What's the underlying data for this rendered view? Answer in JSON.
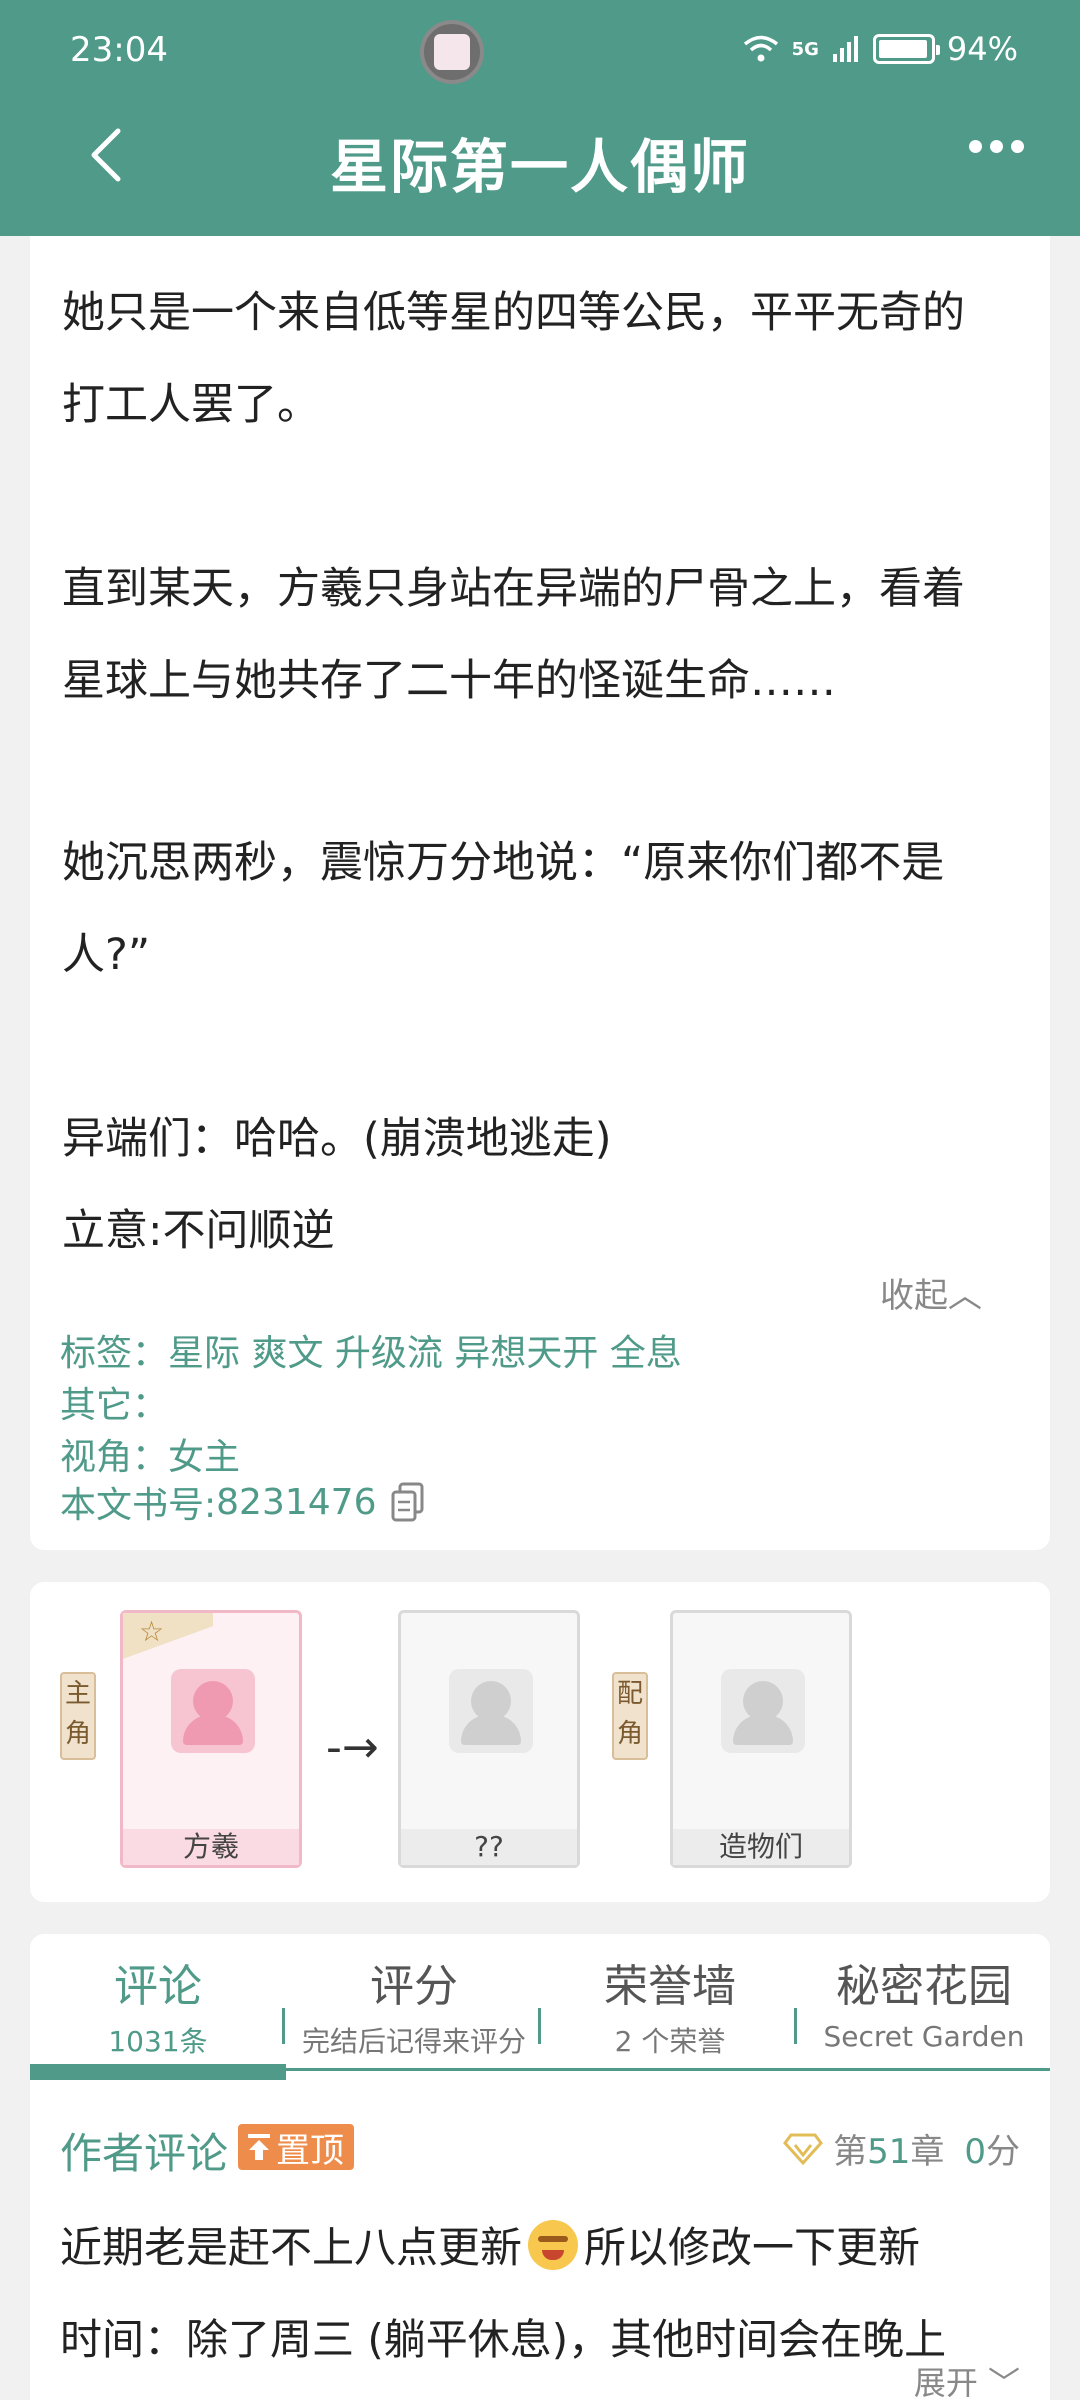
{
  "status_bar": {
    "time": "23:04",
    "network": "5G",
    "battery": "94%"
  },
  "header": {
    "title": "星际第一人偶师"
  },
  "synopsis": {
    "paragraphs": [
      "她只是一个来自低等星的四等公民，平平无奇的",
      "打工人罢了。",
      "直到某天，方羲只身站在异端的尸骨之上，看着",
      "星球上与她共存了二十年的怪诞生命……",
      "她沉思两秒，震惊万分地说：“原来你们都不是",
      "人?”",
      "异端们：哈哈。(崩溃地逃走)",
      "立意:不问顺逆"
    ],
    "collapse_label": "收起︿",
    "tags_label": "标签：",
    "tags": "星际 爽文 升级流 异想天开 全息",
    "other_label": "其它：",
    "perspective_label": "视角：",
    "perspective": "女主",
    "book_id_label": "本文书号:",
    "book_id": "8231476"
  },
  "characters": {
    "main_role_label": "主角",
    "support_role_label": "配角",
    "arrow": "-→",
    "items": [
      {
        "name": "方羲"
      },
      {
        "name": "??"
      },
      {
        "name": "造物们"
      }
    ]
  },
  "tabs": [
    {
      "label": "评论",
      "sub": "1031条"
    },
    {
      "label": "评分",
      "sub": "完结后记得来评分"
    },
    {
      "label": "荣誉墙",
      "sub": "2 个荣誉"
    },
    {
      "label": "秘密花园",
      "sub": "Secret Garden"
    }
  ],
  "author_comment": {
    "label": "作者评论",
    "pin_label": "置顶",
    "chapter_prefix": "第",
    "chapter_num": "51",
    "chapter_suffix": "章",
    "score_num": "0",
    "score_suffix": "分",
    "line1_a": "近期老是赶不上八点更新",
    "line1_b": "所以修改一下更新",
    "line2": "时间：除了周三 (躺平休息)，其他时间会在晚上",
    "expand_label": "展开 ﹀"
  },
  "colors": {
    "accent": "#4f9a89",
    "pin": "#ee8d4b"
  }
}
